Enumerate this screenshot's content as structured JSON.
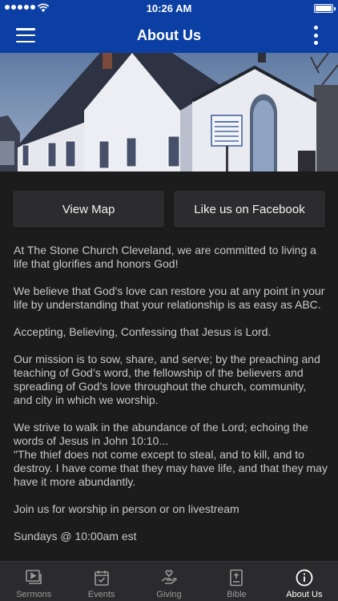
{
  "status_bar": {
    "time": "10:26 AM"
  },
  "header": {
    "title": "About Us"
  },
  "buttons": {
    "map": "View Map",
    "facebook": "Like us on Facebook"
  },
  "about": {
    "paragraphs": [
      "At The Stone Church Cleveland, we are committed to living a life that glorifies and honors God!",
      "We believe that God's love can restore you at any point in your life by understanding that your relationship is as easy as ABC.",
      "Accepting, Believing, Confessing that Jesus is Lord.",
      "Our mission is to sow, share, and serve; by the preaching and teaching of God’s word, the fellowship of the believers and spreading of God’s love throughout the church, community, and city in which we worship.",
      "We strive to walk in the abundance of the Lord; echoing the words of Jesus in John 10:10...",
      "\"The thief does not come except to steal, and to kill, and to destroy.  I have come that they may have life, and that they may have it more abundantly.",
      "Join us for worship in person or on livestream",
      "Sundays @ 10:00am est"
    ]
  },
  "tabs": [
    {
      "label": "Sermons",
      "icon": "sermons-video-icon"
    },
    {
      "label": "Events",
      "icon": "calendar-check-icon"
    },
    {
      "label": "Giving",
      "icon": "giving-hand-heart-icon"
    },
    {
      "label": "Bible",
      "icon": "bible-book-icon"
    },
    {
      "label": "About Us",
      "icon": "info-circle-icon"
    }
  ],
  "colors": {
    "nav_bar": "#0c3fa3",
    "background": "#1c1c1d",
    "button": "#2c2c2e",
    "tab_bar": "#2b2b2d",
    "tab_inactive": "#9a9a9a",
    "tab_active": "#ffffff"
  }
}
